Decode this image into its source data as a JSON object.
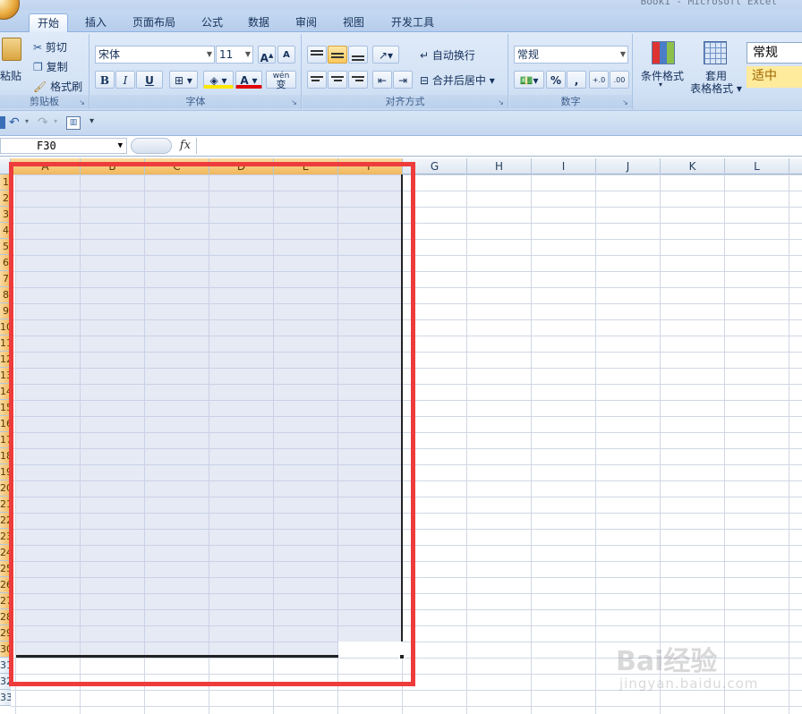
{
  "window": {
    "title": "Book1 - Microsoft Excel"
  },
  "tabs": [
    "开始",
    "插入",
    "页面布局",
    "公式",
    "数据",
    "审阅",
    "视图",
    "开发工具"
  ],
  "active_tab": "开始",
  "clipboard": {
    "paste": "粘贴",
    "cut": "剪切",
    "copy": "复制",
    "format_painter": "格式刷",
    "label": "剪贴板"
  },
  "font": {
    "name": "宋体",
    "size": "11",
    "bold": "B",
    "italic": "I",
    "underline": "U",
    "phonetic": "wén",
    "label": "字体"
  },
  "alignment": {
    "wrap_text": "自动换行",
    "merge_center": "合并后居中",
    "label": "对齐方式"
  },
  "number": {
    "format": "常规",
    "percent": "%",
    "comma": ",",
    "label": "数字"
  },
  "styles": {
    "conditional_formatting": "条件格式",
    "format_as_table_1": "套用",
    "format_as_table_2": "表格格式",
    "style_normal": "常规",
    "style_neutral": "适中"
  },
  "formula_bar": {
    "name_box": "F30",
    "fx": "fx",
    "value": ""
  },
  "columns": [
    "A",
    "B",
    "C",
    "D",
    "E",
    "F",
    "G",
    "H",
    "I",
    "J",
    "K",
    "L"
  ],
  "rows": [
    "1",
    "2",
    "3",
    "4",
    "5",
    "6",
    "7",
    "8",
    "9",
    "10",
    "11",
    "12",
    "13",
    "14",
    "15",
    "16",
    "17",
    "18",
    "19",
    "20",
    "21",
    "22",
    "23",
    "24",
    "25",
    "26",
    "27",
    "28",
    "29",
    "30",
    "31",
    "32",
    "33"
  ],
  "selection": {
    "range": "A1:F30",
    "active_cell": "F30"
  },
  "watermark": {
    "text": "Bai经验",
    "url": "jingyan.baidu.com"
  },
  "colors": {
    "selection_outline": "#ee3b3b",
    "header_selected": "#f1b75b",
    "ribbon": "#d3e2f5"
  }
}
